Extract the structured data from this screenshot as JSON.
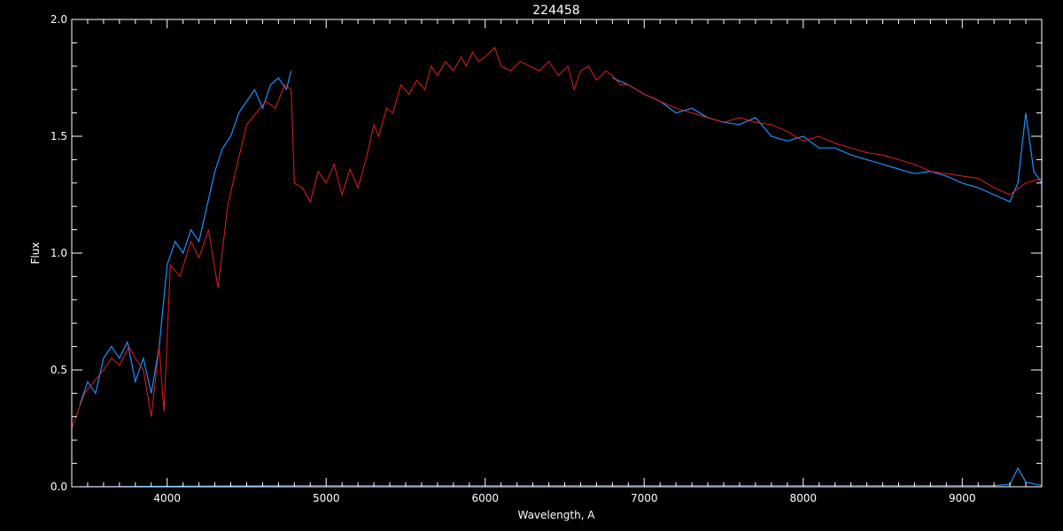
{
  "chart_data": {
    "type": "line",
    "title": "224458",
    "xlabel": "Wavelength, A",
    "ylabel": "Flux",
    "xlim": [
      3400,
      9500
    ],
    "ylim": [
      0.0,
      2.0
    ],
    "x_ticks": [
      4000,
      5000,
      6000,
      7000,
      8000,
      9000
    ],
    "x_tick_labels": [
      "4000",
      "5000",
      "6000",
      "7000",
      "8000",
      "9000"
    ],
    "y_ticks": [
      0.0,
      0.5,
      1.0,
      1.5,
      2.0
    ],
    "y_tick_labels": [
      "0.0",
      "0.5",
      "1.0",
      "1.5",
      "2.0"
    ],
    "grid": false,
    "colors": {
      "background": "#000000",
      "axes": "#ffffff",
      "observed": "#1e90ff",
      "model": "#e0201c",
      "white_trace": "#ffffff"
    },
    "series": [
      {
        "role": "model",
        "color": "#e0201c",
        "x": [
          3400,
          3480,
          3540,
          3600,
          3650,
          3700,
          3760,
          3800,
          3850,
          3900,
          3950,
          3980,
          4020,
          4080,
          4150,
          4200,
          4260,
          4320,
          4380,
          4430,
          4500,
          4560,
          4620,
          4680,
          4740,
          4780,
          4800,
          4850,
          4900,
          4950,
          5000,
          5050,
          5100,
          5150,
          5200,
          5250,
          5300,
          5330,
          5380,
          5420,
          5470,
          5520,
          5570,
          5620,
          5660,
          5700,
          5750,
          5800,
          5850,
          5880,
          5920,
          5960,
          6000,
          6060,
          6100,
          6160,
          6220,
          6280,
          6340,
          6400,
          6460,
          6520,
          6560,
          6600,
          6650,
          6700,
          6760,
          6800,
          6850,
          6900,
          6950,
          7000,
          7100,
          7200,
          7300,
          7400,
          7500,
          7600,
          7700,
          7800,
          7900,
          8000,
          8100,
          8200,
          8300,
          8400,
          8500,
          8600,
          8700,
          8800,
          8900,
          9000,
          9100,
          9200,
          9300,
          9400,
          9500
        ],
        "y": [
          0.25,
          0.4,
          0.45,
          0.5,
          0.55,
          0.52,
          0.6,
          0.55,
          0.5,
          0.3,
          0.6,
          0.32,
          0.95,
          0.9,
          1.05,
          0.98,
          1.1,
          0.85,
          1.2,
          1.35,
          1.55,
          1.6,
          1.65,
          1.62,
          1.72,
          1.7,
          1.3,
          1.28,
          1.22,
          1.35,
          1.3,
          1.38,
          1.25,
          1.36,
          1.28,
          1.4,
          1.55,
          1.5,
          1.62,
          1.6,
          1.72,
          1.68,
          1.74,
          1.7,
          1.8,
          1.76,
          1.82,
          1.78,
          1.84,
          1.8,
          1.86,
          1.82,
          1.84,
          1.88,
          1.8,
          1.78,
          1.82,
          1.8,
          1.78,
          1.82,
          1.76,
          1.8,
          1.7,
          1.78,
          1.8,
          1.74,
          1.78,
          1.76,
          1.72,
          1.72,
          1.7,
          1.68,
          1.65,
          1.62,
          1.6,
          1.58,
          1.56,
          1.58,
          1.56,
          1.55,
          1.52,
          1.48,
          1.5,
          1.47,
          1.45,
          1.43,
          1.42,
          1.4,
          1.38,
          1.35,
          1.34,
          1.33,
          1.32,
          1.28,
          1.25,
          1.3,
          1.32
        ]
      },
      {
        "role": "observed_blue",
        "color": "#1e90ff",
        "x": [
          3450,
          3500,
          3550,
          3600,
          3650,
          3700,
          3750,
          3800,
          3850,
          3900,
          3950,
          4000,
          4050,
          4100,
          4150,
          4200,
          4250,
          4300,
          4350,
          4400,
          4450,
          4500,
          4550,
          4600,
          4650,
          4700,
          4750,
          4780
        ],
        "y": [
          0.35,
          0.45,
          0.4,
          0.55,
          0.6,
          0.55,
          0.62,
          0.45,
          0.55,
          0.4,
          0.6,
          0.95,
          1.05,
          1.0,
          1.1,
          1.05,
          1.2,
          1.35,
          1.45,
          1.5,
          1.6,
          1.65,
          1.7,
          1.62,
          1.72,
          1.75,
          1.7,
          1.78
        ]
      },
      {
        "role": "observed_blue_red_arm",
        "color": "#1e90ff",
        "x": [
          6800,
          6900,
          7000,
          7100,
          7200,
          7300,
          7400,
          7500,
          7600,
          7700,
          7800,
          7900,
          8000,
          8100,
          8200,
          8300,
          8400,
          8500,
          8600,
          8700,
          8800,
          8900,
          9000,
          9100,
          9200,
          9300,
          9350,
          9400,
          9450,
          9500
        ],
        "y": [
          1.75,
          1.72,
          1.68,
          1.65,
          1.6,
          1.62,
          1.58,
          1.56,
          1.55,
          1.58,
          1.5,
          1.48,
          1.5,
          1.45,
          1.45,
          1.42,
          1.4,
          1.38,
          1.36,
          1.34,
          1.35,
          1.33,
          1.3,
          1.28,
          1.25,
          1.22,
          1.3,
          1.6,
          1.35,
          1.3
        ]
      },
      {
        "role": "error_blue",
        "color": "#1e90ff",
        "x": [
          3450,
          4800,
          6800,
          9200,
          9300,
          9350,
          9400,
          9500
        ],
        "y": [
          0.0,
          0.005,
          0.005,
          0.005,
          0.01,
          0.08,
          0.02,
          0.005
        ]
      }
    ]
  }
}
